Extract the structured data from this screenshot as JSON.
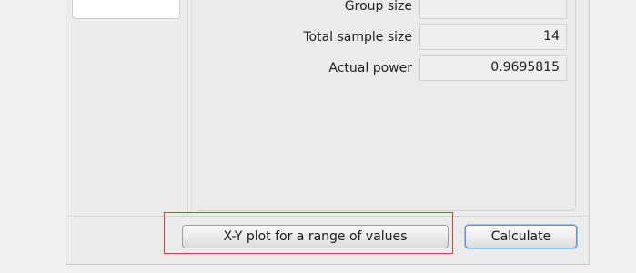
{
  "form": {
    "partial_label": "Group size",
    "total_sample_size": {
      "label": "Total sample size",
      "value": "14"
    },
    "actual_power": {
      "label": "Actual power",
      "value": "0.9695815"
    }
  },
  "buttons": {
    "plot_label": "X-Y plot for a range of values",
    "calculate_label": "Calculate"
  },
  "colors": {
    "highlight": "#d84040",
    "default_button_focus": "#5b8fcf"
  }
}
